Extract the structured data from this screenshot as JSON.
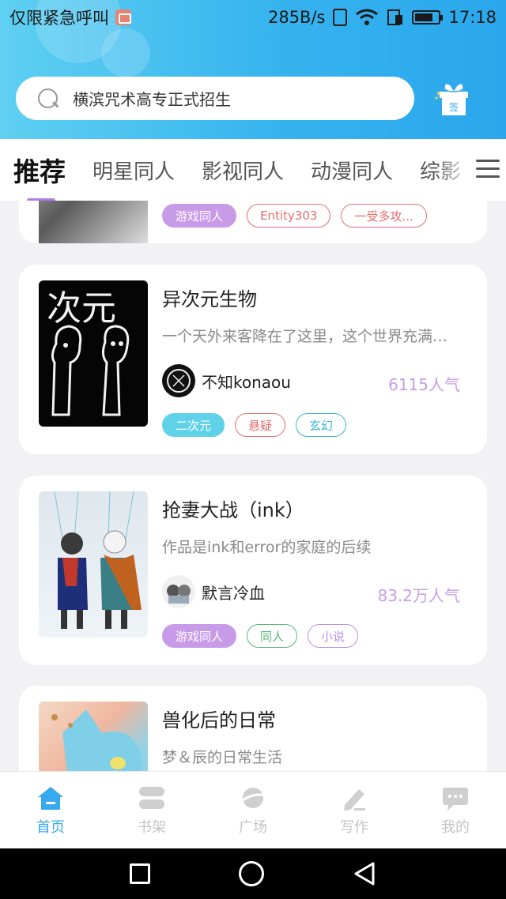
{
  "status_bar": {
    "left_text": "仅限紧急呼叫",
    "speed": "285B/s",
    "time": "17:18"
  },
  "search": {
    "text": "横滨咒术高专正式招生",
    "gift_label": "签"
  },
  "tabs": [
    {
      "label": "推荐"
    },
    {
      "label": "明星同人"
    },
    {
      "label": "影视同人"
    },
    {
      "label": "动漫同人"
    },
    {
      "label": "综影"
    }
  ],
  "cards": [
    {
      "tags": [
        "游戏同人",
        "Entity303",
        "一受多攻..."
      ]
    },
    {
      "title": "异次元生物",
      "desc": "一个天外来客降在了这里，这个世界充满了未知",
      "author": "不知konaou",
      "popularity": "6115人气",
      "tags": [
        "二次元",
        "悬疑",
        "玄幻"
      ],
      "cover_text": "次元"
    },
    {
      "title": "抢妻大战（ink）",
      "desc": "作品是ink和error的家庭的后续",
      "author": "默言冷血",
      "popularity": "83.2万人气",
      "tags": [
        "游戏同人",
        "同人",
        "小说"
      ]
    },
    {
      "title": "兽化后的日常",
      "desc": "梦＆辰的日常生活"
    }
  ],
  "bottom_nav": [
    {
      "label": "首页",
      "active": true
    },
    {
      "label": "书架"
    },
    {
      "label": "广场"
    },
    {
      "label": "写作"
    },
    {
      "label": "我的"
    }
  ],
  "colors": {
    "accent_blue": "#37a9ee",
    "tab_indicator": "#b27fe0",
    "popularity": "#c59ee9"
  }
}
